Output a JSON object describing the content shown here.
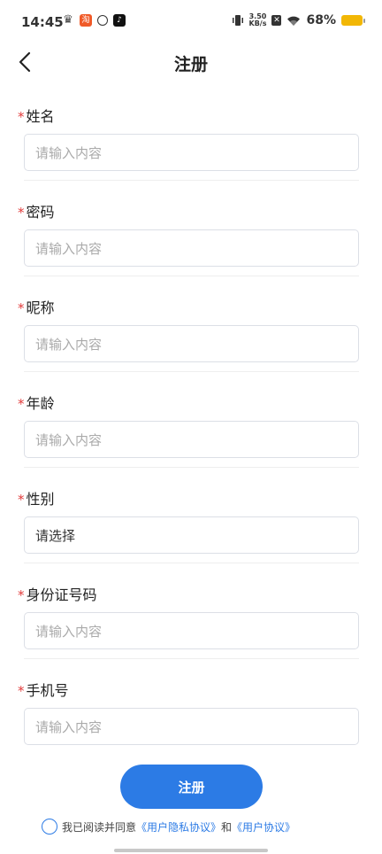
{
  "status_bar": {
    "time": "14:45",
    "net_speed_value": "3.50",
    "net_speed_unit": "KB/s",
    "battery_percent": "68%",
    "battery_color": "#f2b705",
    "icons": [
      "crown-icon",
      "app-icon",
      "link-icon",
      "tiktok-icon",
      "vibrate-icon",
      "no-sim-icon",
      "wifi-icon",
      "battery-icon"
    ]
  },
  "nav": {
    "title": "注册",
    "back_icon": "chevron-left-icon"
  },
  "form": {
    "required_mark": "*",
    "fields": [
      {
        "label": "姓名",
        "placeholder": "请输入内容"
      },
      {
        "label": "密码",
        "placeholder": "请输入内容"
      },
      {
        "label": "昵称",
        "placeholder": "请输入内容"
      },
      {
        "label": "年龄",
        "placeholder": "请输入内容"
      },
      {
        "label": "性别",
        "value": "请选择"
      },
      {
        "label": "身份证号码",
        "placeholder": "请输入内容"
      },
      {
        "label": "手机号",
        "placeholder": "请输入内容"
      }
    ]
  },
  "submit": {
    "label": "注册",
    "color": "#2c7be5"
  },
  "agreement": {
    "prefix": "我已阅读并同意",
    "privacy_link": "《用户隐私协议》",
    "joiner": "和",
    "user_link": "《用户协议》"
  }
}
